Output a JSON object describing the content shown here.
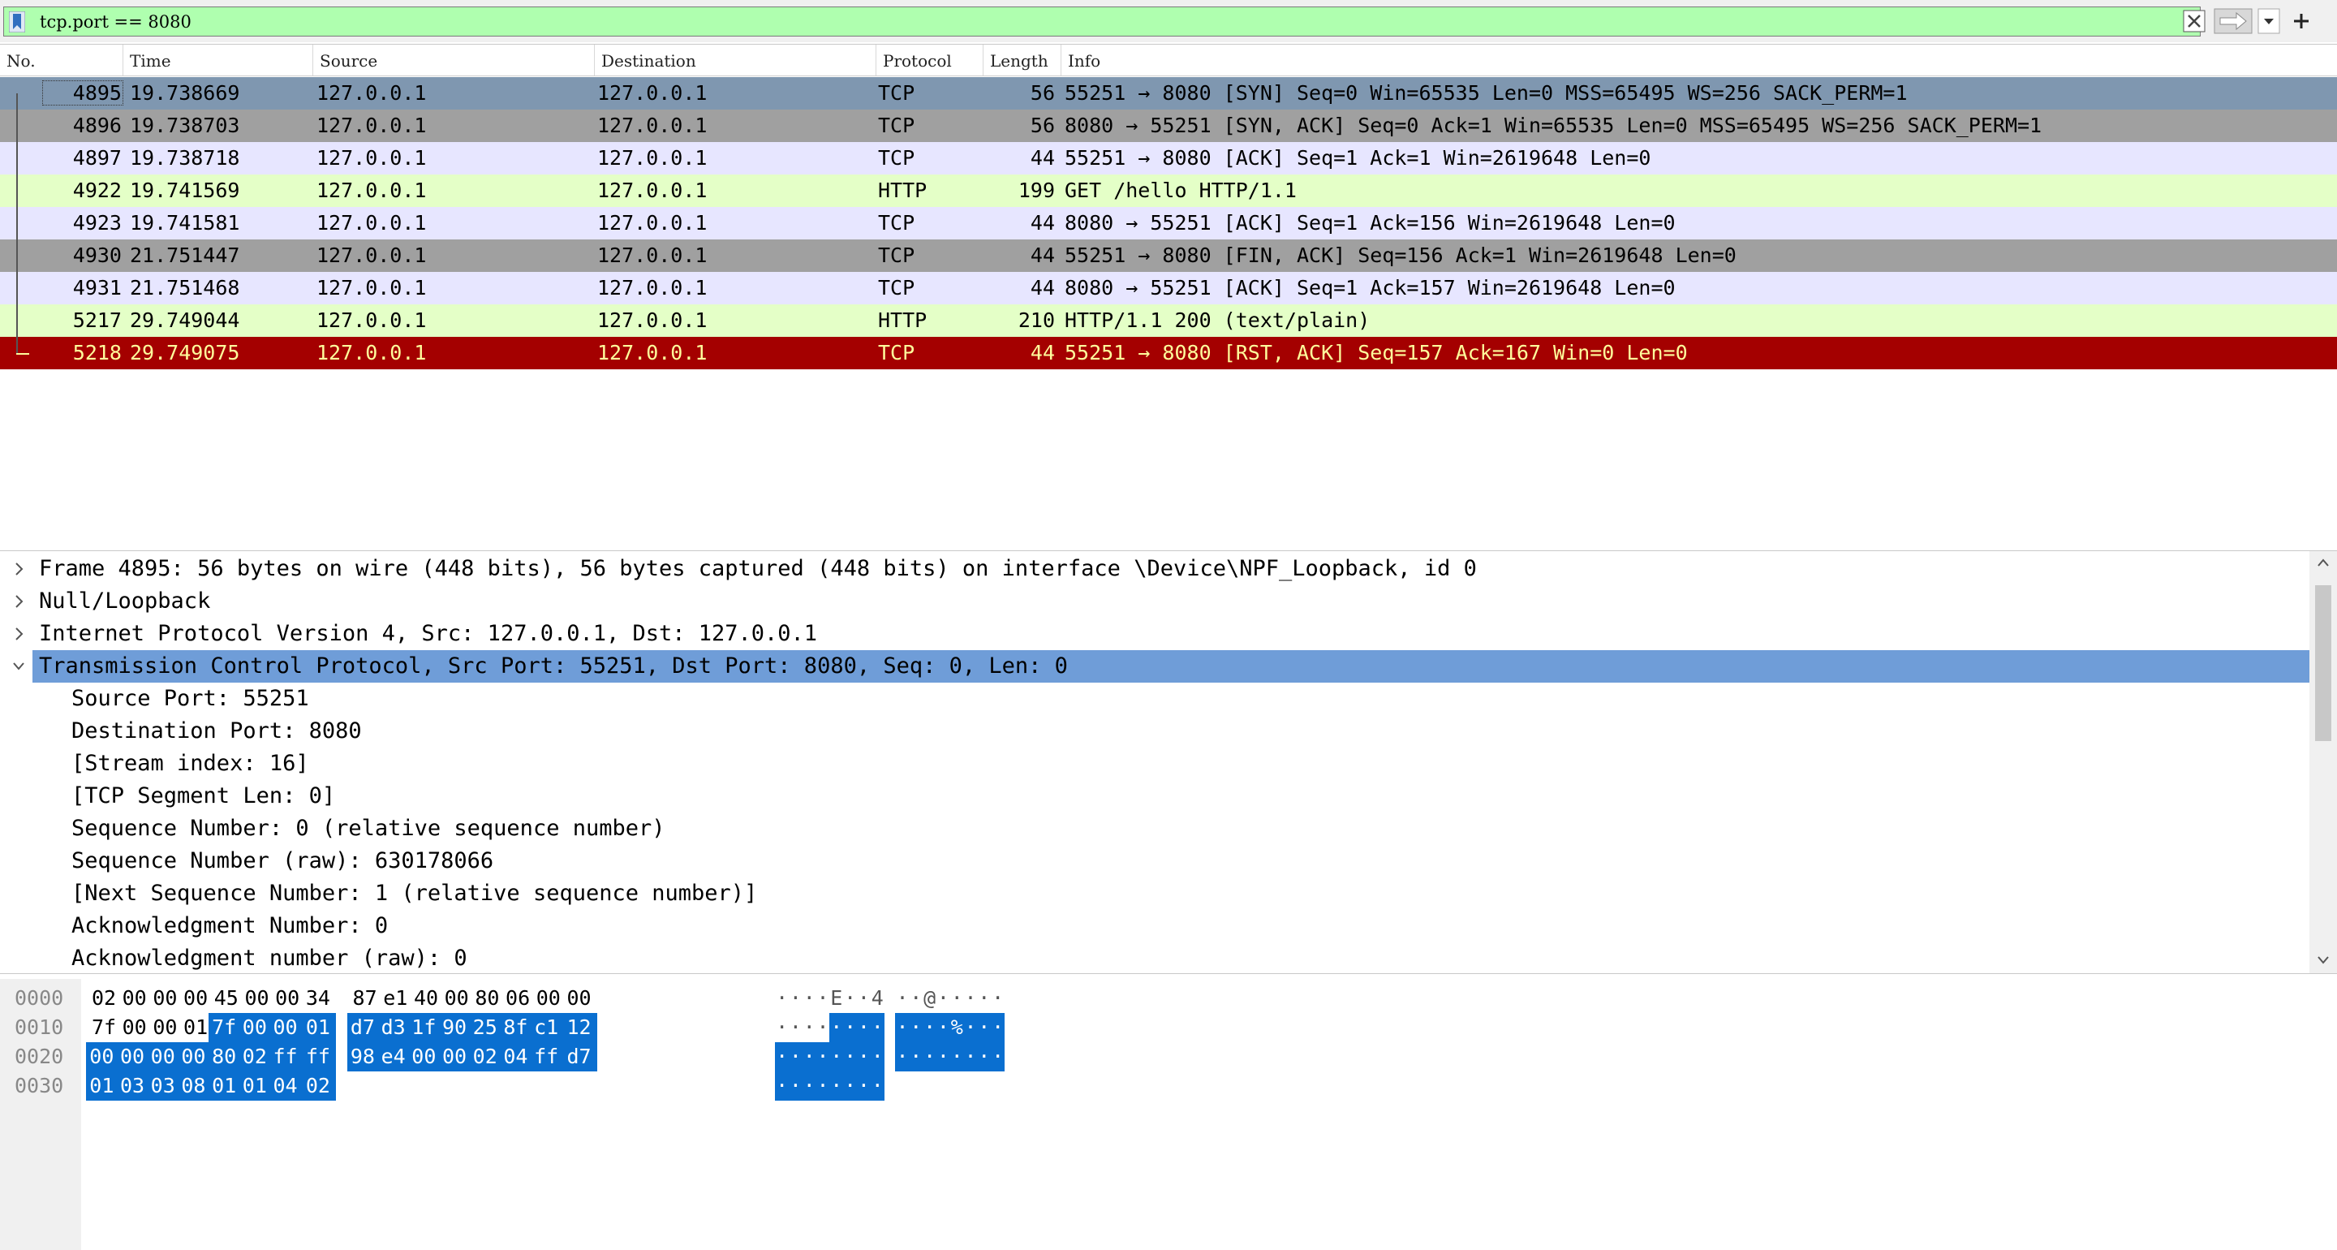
{
  "filter": {
    "value": "tcp.port == 8080",
    "placeholder": ""
  },
  "packet_list": {
    "columns": [
      "No.",
      "Time",
      "Source",
      "Destination",
      "Protocol",
      "Length",
      "Info"
    ],
    "rows": [
      {
        "no": "4895",
        "time": "19.738669",
        "src": "127.0.0.1",
        "dst": "127.0.0.1",
        "proto": "TCP",
        "len": "56",
        "info": "55251 → 8080 [SYN] Seq=0 Win=65535 Len=0 MSS=65495 WS=256 SACK_PERM=1",
        "bg": "#7f97b0",
        "fg": "#000000"
      },
      {
        "no": "4896",
        "time": "19.738703",
        "src": "127.0.0.1",
        "dst": "127.0.0.1",
        "proto": "TCP",
        "len": "56",
        "info": "8080 → 55251 [SYN, ACK] Seq=0 Ack=1 Win=65535 Len=0 MSS=65495 WS=256 SACK_PERM=1",
        "bg": "#a0a0a0",
        "fg": "#000000"
      },
      {
        "no": "4897",
        "time": "19.738718",
        "src": "127.0.0.1",
        "dst": "127.0.0.1",
        "proto": "TCP",
        "len": "44",
        "info": "55251 → 8080 [ACK] Seq=1 Ack=1 Win=2619648 Len=0",
        "bg": "#e7e6ff",
        "fg": "#000000"
      },
      {
        "no": "4922",
        "time": "19.741569",
        "src": "127.0.0.1",
        "dst": "127.0.0.1",
        "proto": "HTTP",
        "len": "199",
        "info": "GET /hello HTTP/1.1",
        "bg": "#e4ffc7",
        "fg": "#000000"
      },
      {
        "no": "4923",
        "time": "19.741581",
        "src": "127.0.0.1",
        "dst": "127.0.0.1",
        "proto": "TCP",
        "len": "44",
        "info": "8080 → 55251 [ACK] Seq=1 Ack=156 Win=2619648 Len=0",
        "bg": "#e7e6ff",
        "fg": "#000000"
      },
      {
        "no": "4930",
        "time": "21.751447",
        "src": "127.0.0.1",
        "dst": "127.0.0.1",
        "proto": "TCP",
        "len": "44",
        "info": "55251 → 8080 [FIN, ACK] Seq=156 Ack=1 Win=2619648 Len=0",
        "bg": "#a0a0a0",
        "fg": "#000000"
      },
      {
        "no": "4931",
        "time": "21.751468",
        "src": "127.0.0.1",
        "dst": "127.0.0.1",
        "proto": "TCP",
        "len": "44",
        "info": "8080 → 55251 [ACK] Seq=1 Ack=157 Win=2619648 Len=0",
        "bg": "#e7e6ff",
        "fg": "#000000"
      },
      {
        "no": "5217",
        "time": "29.749044",
        "src": "127.0.0.1",
        "dst": "127.0.0.1",
        "proto": "HTTP",
        "len": "210",
        "info": "HTTP/1.1 200   (text/plain)",
        "bg": "#e4ffc7",
        "fg": "#000000"
      },
      {
        "no": "5218",
        "time": "29.749075",
        "src": "127.0.0.1",
        "dst": "127.0.0.1",
        "proto": "TCP",
        "len": "44",
        "info": "55251 → 8080 [RST, ACK] Seq=157 Ack=167 Win=0 Len=0",
        "bg": "#a40000",
        "fg": "#fffc9c"
      }
    ]
  },
  "details": {
    "lines": [
      {
        "text": "Frame 4895: 56 bytes on wire (448 bits), 56 bytes captured (448 bits) on interface \\Device\\NPF_Loopback, id 0",
        "expander": "collapsed",
        "child": false,
        "selected": false
      },
      {
        "text": "Null/Loopback",
        "expander": "collapsed",
        "child": false,
        "selected": false
      },
      {
        "text": "Internet Protocol Version 4, Src: 127.0.0.1, Dst: 127.0.0.1",
        "expander": "collapsed",
        "child": false,
        "selected": false
      },
      {
        "text": "Transmission Control Protocol, Src Port: 55251, Dst Port: 8080, Seq: 0, Len: 0",
        "expander": "expanded",
        "child": false,
        "selected": true
      },
      {
        "text": "Source Port: 55251",
        "expander": "none",
        "child": true,
        "selected": false
      },
      {
        "text": "Destination Port: 8080",
        "expander": "none",
        "child": true,
        "selected": false
      },
      {
        "text": "[Stream index: 16]",
        "expander": "none",
        "child": true,
        "selected": false
      },
      {
        "text": "[TCP Segment Len: 0]",
        "expander": "none",
        "child": true,
        "selected": false
      },
      {
        "text": "Sequence Number: 0    (relative sequence number)",
        "expander": "none",
        "child": true,
        "selected": false
      },
      {
        "text": "Sequence Number (raw): 630178066",
        "expander": "none",
        "child": true,
        "selected": false
      },
      {
        "text": "[Next Sequence Number: 1    (relative sequence number)]",
        "expander": "none",
        "child": true,
        "selected": false
      },
      {
        "text": "Acknowledgment Number: 0",
        "expander": "none",
        "child": true,
        "selected": false
      },
      {
        "text": "Acknowledgment number (raw): 0",
        "expander": "none",
        "child": true,
        "selected": false
      }
    ]
  },
  "bytes": {
    "highlight_start": 20,
    "rows": [
      {
        "offset": "0000",
        "hex": [
          "02",
          "00",
          "00",
          "00",
          "45",
          "00",
          "00",
          "34",
          "87",
          "e1",
          "40",
          "00",
          "80",
          "06",
          "00",
          "00"
        ],
        "ascii": [
          "·",
          "·",
          "·",
          "·",
          "E",
          "·",
          "·",
          "4",
          "·",
          "·",
          "@",
          "·",
          "·",
          "·",
          "·",
          "·"
        ]
      },
      {
        "offset": "0010",
        "hex": [
          "7f",
          "00",
          "00",
          "01",
          "7f",
          "00",
          "00",
          "01",
          "d7",
          "d3",
          "1f",
          "90",
          "25",
          "8f",
          "c1",
          "12"
        ],
        "ascii": [
          "·",
          "·",
          "·",
          "·",
          "·",
          "·",
          "·",
          "·",
          "·",
          "·",
          "·",
          "·",
          "%",
          "·",
          "·",
          "·"
        ]
      },
      {
        "offset": "0020",
        "hex": [
          "00",
          "00",
          "00",
          "00",
          "80",
          "02",
          "ff",
          "ff",
          "98",
          "e4",
          "00",
          "00",
          "02",
          "04",
          "ff",
          "d7"
        ],
        "ascii": [
          "·",
          "·",
          "·",
          "·",
          "·",
          "·",
          "·",
          "·",
          "·",
          "·",
          "·",
          "·",
          "·",
          "·",
          "·",
          "·"
        ]
      },
      {
        "offset": "0030",
        "hex": [
          "01",
          "03",
          "03",
          "08",
          "01",
          "01",
          "04",
          "02"
        ],
        "ascii": [
          "·",
          "·",
          "·",
          "·",
          "·",
          "·",
          "·",
          "·"
        ]
      }
    ]
  },
  "colors": {
    "filter_valid": "#afffaf",
    "selection": "#6f9dd8",
    "bytes_highlight": "#0a6fd0"
  },
  "icons": [
    "bookmark-icon",
    "clear-icon",
    "apply-arrow-icon",
    "chevron-down-icon",
    "plus-icon",
    "chevron-right-icon",
    "chevron-down-icon",
    "scroll-up-icon",
    "scroll-down-icon"
  ]
}
